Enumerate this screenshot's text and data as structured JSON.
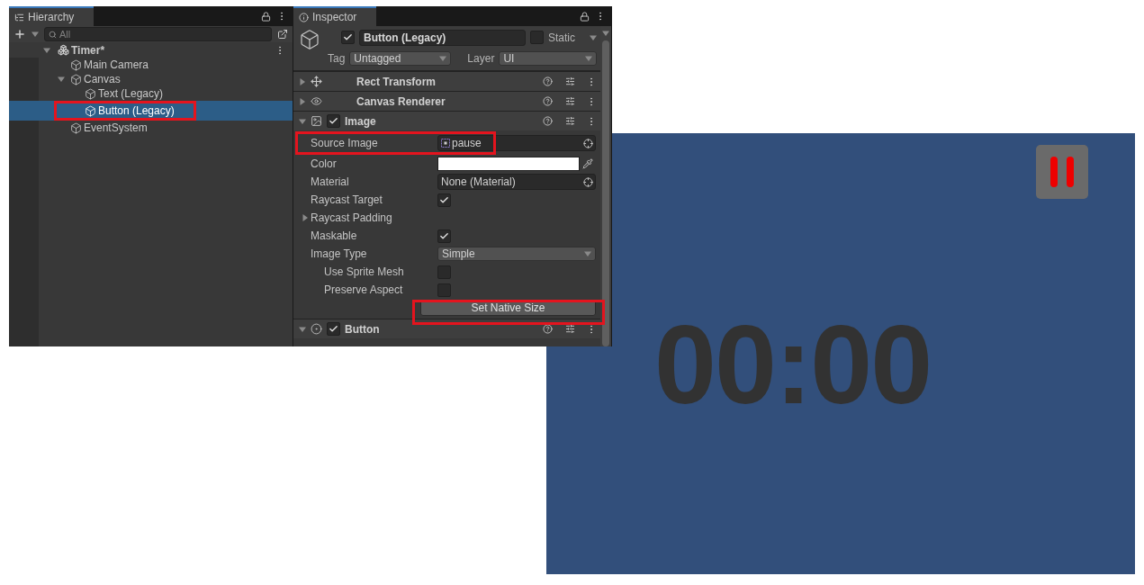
{
  "hierarchy": {
    "title": "Hierarchy",
    "search": {
      "placeholder": "All"
    },
    "scene": {
      "name": "Timer*",
      "expanded": true,
      "children": [
        {
          "name": "Main Camera",
          "selected": false
        },
        {
          "name": "Canvas",
          "selected": false,
          "expanded": true,
          "children": [
            {
              "name": "Text (Legacy)",
              "selected": false
            },
            {
              "name": "Button (Legacy)",
              "selected": true
            }
          ]
        },
        {
          "name": "EventSystem",
          "selected": false
        }
      ]
    }
  },
  "inspector": {
    "title": "Inspector",
    "object": {
      "active": true,
      "name": "Button (Legacy)",
      "static": false,
      "static_label": "Static",
      "tag_label": "Tag",
      "tag": "Untagged",
      "layer_label": "Layer",
      "layer": "UI"
    },
    "components": [
      {
        "kind": "plain",
        "name": "Rect Transform",
        "expanded": false
      },
      {
        "kind": "plain",
        "name": "Canvas Renderer",
        "expanded": false
      },
      {
        "kind": "toggle",
        "name": "Image",
        "expanded": true,
        "enabled": true,
        "properties": [
          {
            "kind": "object",
            "label": "Source Image",
            "value": "pause",
            "sprite": true
          },
          {
            "kind": "color",
            "label": "Color",
            "color": "#ffffff"
          },
          {
            "kind": "object",
            "label": "Material",
            "value": "None (Material)",
            "sprite": false
          },
          {
            "kind": "checkbox",
            "label": "Raycast Target",
            "checked": true
          },
          {
            "kind": "foldout",
            "label": "Raycast Padding",
            "expanded": false
          },
          {
            "kind": "checkbox",
            "label": "Maskable",
            "checked": true
          },
          {
            "kind": "dropdown",
            "label": "Image Type",
            "value": "Simple",
            "children": [
              {
                "kind": "checkbox",
                "label": "Use Sprite Mesh",
                "checked": false
              },
              {
                "kind": "checkbox",
                "label": "Preserve Aspect",
                "checked": false
              }
            ]
          },
          {
            "kind": "button",
            "label": "Set Native Size"
          }
        ]
      },
      {
        "kind": "toggle",
        "name": "Button",
        "expanded": true,
        "enabled": true
      }
    ]
  },
  "game": {
    "timer": "00:00"
  }
}
